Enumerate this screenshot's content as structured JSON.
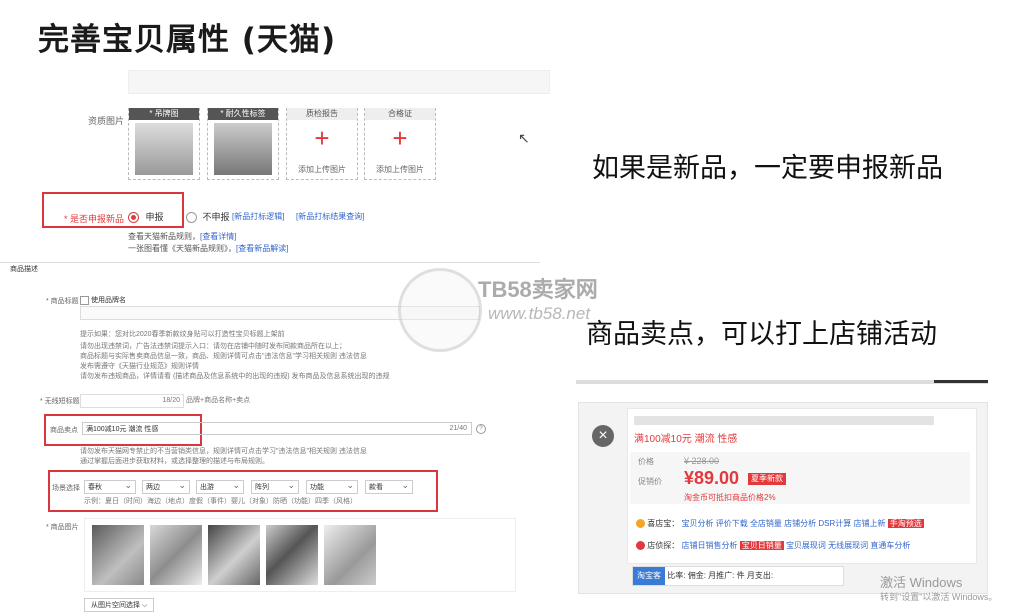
{
  "page_title": "完善宝贝属性 (天猫)",
  "annotations": {
    "new_product": "如果是新品，一定要申报新品",
    "selling_point": "商品卖点，可以打上店铺活动"
  },
  "watermark": {
    "brand": "TB58卖家网",
    "url": "www.tb58.net"
  },
  "qualification": {
    "label": "资质图片",
    "slots": [
      {
        "caption": "* 吊牌图"
      },
      {
        "caption": "* 耐久性标签"
      },
      {
        "caption": "质检报告",
        "add_text": "添加上传图片"
      },
      {
        "caption": "合格证",
        "add_text": "添加上传图片"
      }
    ]
  },
  "new_product": {
    "label": "* 是否申报新品",
    "option_yes": "申报",
    "option_no": "不申报",
    "link1": "[新品打标逻辑]",
    "link2": "[新品打标结果查询]",
    "note1": "查看天猫新品规则，",
    "note1_link": "[查看详情]",
    "note2": "一张图看懂《天猫新品规则》，",
    "note2_link": "[查看新品解读]"
  },
  "form": {
    "section": "商品描述",
    "title_label": "* 商品标题",
    "use_brand": "使用品牌名",
    "hint_main": "提示如果：您对比2020春季新款纹身贴可以打造性宝贝标题上架前",
    "hint_lines": [
      "请勿出现违禁词，广告法违禁词提示入口：请勿在店铺中随时发布同款商品所在以上；",
      "商品标题与实际售卖商品信息一致，商品、规则详情可点击\"违法信息\"学习相关规则 违法信息",
      "发布需遵守《天猫行业规范》规则详情",
      "请勿发布违规商品，详情请看 (描述商品及信息系统中的出现的违规) 发布商品及信息系统出现的违规"
    ],
    "short_title_label": "* 无线短标题",
    "short_title_count": "18/20",
    "short_title_suffix": "品牌+商品名称+卖点",
    "selling_label": "商品卖点",
    "selling_value": "满100减10元 潮流 性感",
    "selling_count": "21/40",
    "selling_hints": [
      "请勿发布天猫网专禁止的不当营销类信息，规则详情可点击学习\"违法信息\"相关规则 违法信息",
      "通过掌握后面进步获取材料，或选择整理的描述与布局规则。"
    ],
    "attr_label": "场景选择",
    "attr_values": [
      "春秋",
      "两边",
      "出游",
      "阵列",
      "功能",
      "款看"
    ],
    "attr_example": "示例：夏日（时间）海边（地点）度假（事件）婴儿（对象）防晒（功能）四季（风格）",
    "image_label": "* 商品图片",
    "gallery_button": "从图片空间选择 ⌵"
  },
  "product_card": {
    "promo": "满100减10元 潮流 性感",
    "price_label": "价格",
    "original_price": "¥ 228.00",
    "promo_price_label": "促销价",
    "price": "¥89.00",
    "price_tag": "夏季新款",
    "price_note": "淘金币可抵扣商品价格2%",
    "tools_label": "喜店宝：",
    "tools": [
      "宝贝分析",
      "评价下载",
      "全店销量",
      "店铺分析",
      "DSR计算",
      "店铺上新",
      "手淘预选"
    ],
    "tools2_label": "店侦探：",
    "tools2": [
      "店铺日销售分析",
      "宝贝日销量",
      "宝贝展现词",
      "无线展现词",
      "直通车分析"
    ],
    "bottom_tag": "淘宝客",
    "bottom_items": [
      "比率:",
      "佣金:",
      "月推广:",
      "件",
      "月支出:"
    ]
  },
  "windows": {
    "line1": "激活 Windows",
    "line2": "转到\"设置\"以激活 Windows。"
  },
  "colors": {
    "accent_red": "#e4393c",
    "annotation_box": "#d9363e",
    "link": "#3366cc"
  }
}
